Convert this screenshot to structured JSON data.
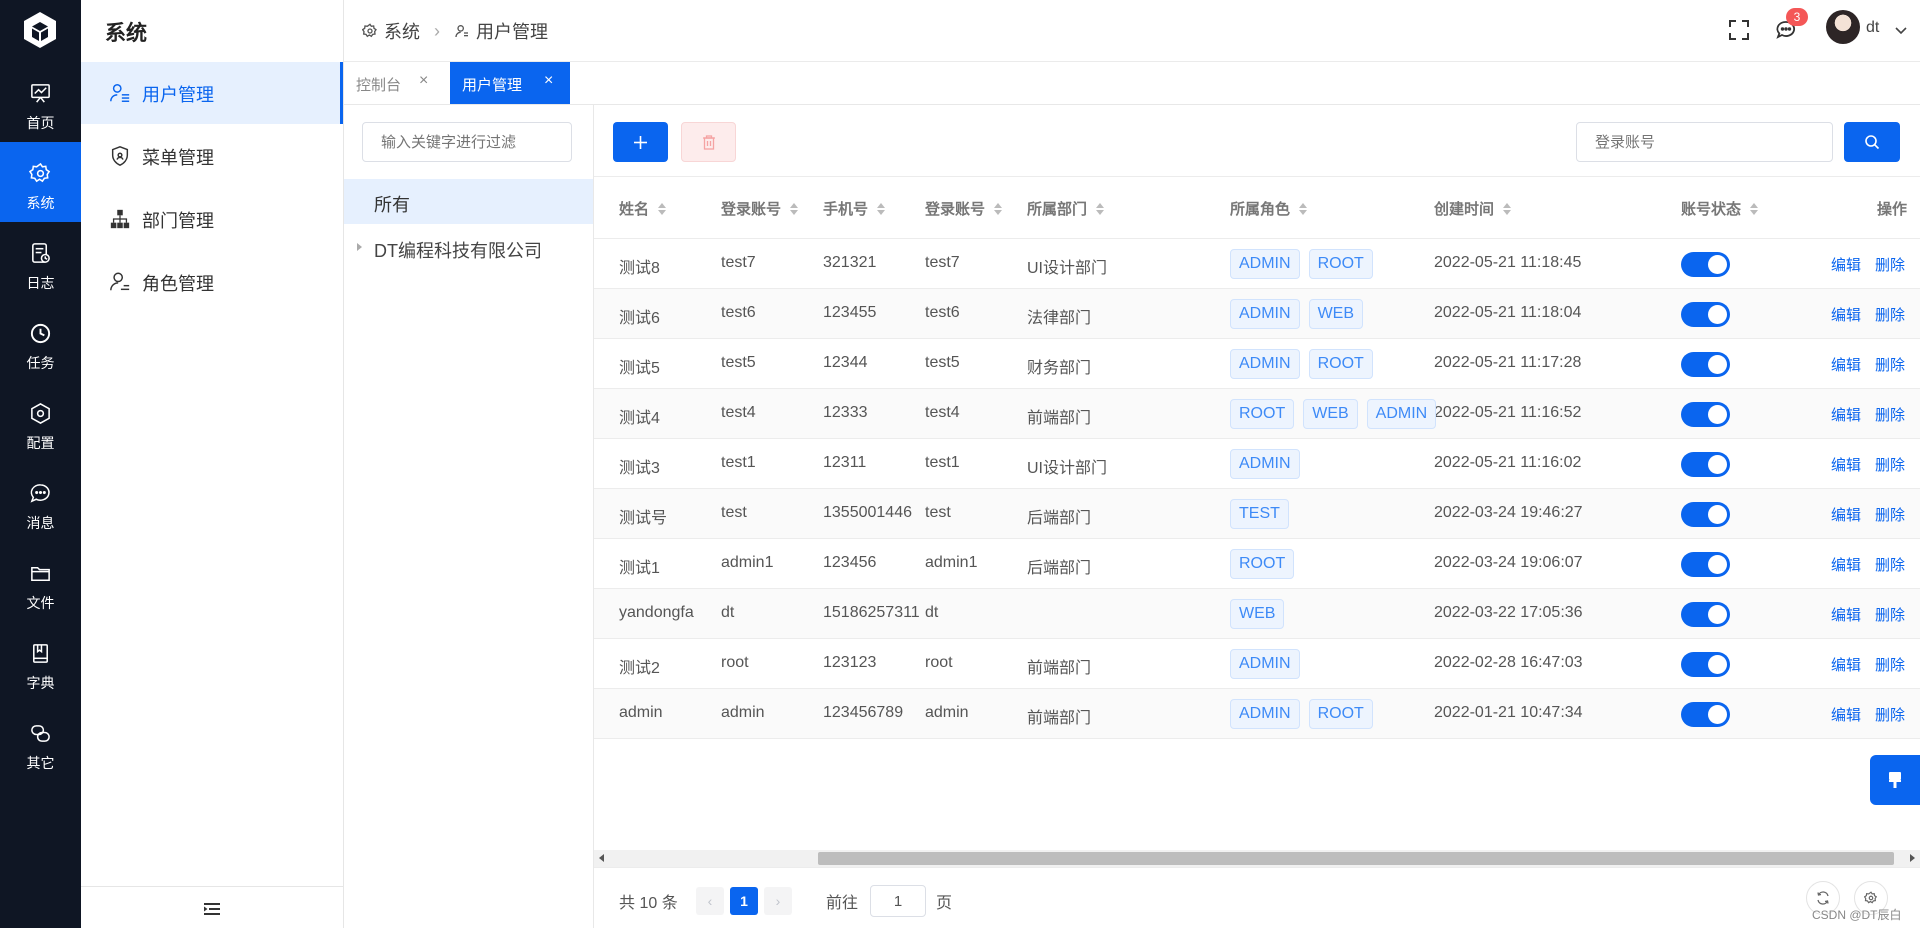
{
  "rail": {
    "items": [
      {
        "label": "首页",
        "icon": "chart-board-icon"
      },
      {
        "label": "系统",
        "icon": "gear-icon"
      },
      {
        "label": "日志",
        "icon": "log-icon"
      },
      {
        "label": "任务",
        "icon": "clock-icon"
      },
      {
        "label": "配置",
        "icon": "hexagon-settings-icon"
      },
      {
        "label": "消息",
        "icon": "chat-icon"
      },
      {
        "label": "文件",
        "icon": "folder-icon"
      },
      {
        "label": "字典",
        "icon": "book-icon"
      },
      {
        "label": "其它",
        "icon": "link-icon"
      }
    ],
    "active_index": 1
  },
  "sidebar": {
    "title": "系统",
    "items": [
      {
        "label": "用户管理",
        "icon": "user-list-icon"
      },
      {
        "label": "菜单管理",
        "icon": "shield-icon"
      },
      {
        "label": "部门管理",
        "icon": "org-chart-icon"
      },
      {
        "label": "角色管理",
        "icon": "user-role-icon"
      }
    ],
    "active_index": 0
  },
  "header": {
    "breadcrumb": [
      "系统",
      "用户管理"
    ],
    "notification_count": "3",
    "user_name": "dt"
  },
  "tabs": [
    {
      "label": "控制台",
      "active": false
    },
    {
      "label": "用户管理",
      "active": true
    }
  ],
  "tree": {
    "filter_placeholder": "输入关键字进行过滤",
    "all_label": "所有",
    "nodes": [
      "DT编程科技有限公司"
    ]
  },
  "toolbar": {
    "search_placeholder": "登录账号"
  },
  "table": {
    "columns": [
      "姓名",
      "登录账号",
      "手机号",
      "登录账号",
      "所属部门",
      "所属角色",
      "创建时间",
      "账号状态",
      "操作"
    ],
    "edit_label": "编辑",
    "delete_label": "删除",
    "rows": [
      {
        "name": "测试8",
        "account": "test7",
        "phone": "321321",
        "login": "test7",
        "dept": "UI设计部门",
        "roles": [
          "ADMIN",
          "ROOT"
        ],
        "created": "2022-05-21 11:18:45",
        "enabled": true
      },
      {
        "name": "测试6",
        "account": "test6",
        "phone": "123455",
        "login": "test6",
        "dept": "法律部门",
        "roles": [
          "ADMIN",
          "WEB"
        ],
        "created": "2022-05-21 11:18:04",
        "enabled": true
      },
      {
        "name": "测试5",
        "account": "test5",
        "phone": "12344",
        "login": "test5",
        "dept": "财务部门",
        "roles": [
          "ADMIN",
          "ROOT"
        ],
        "created": "2022-05-21 11:17:28",
        "enabled": true
      },
      {
        "name": "测试4",
        "account": "test4",
        "phone": "12333",
        "login": "test4",
        "dept": "前端部门",
        "roles": [
          "ROOT",
          "WEB",
          "ADMIN"
        ],
        "created": "2022-05-21 11:16:52",
        "enabled": true
      },
      {
        "name": "测试3",
        "account": "test1",
        "phone": "12311",
        "login": "test1",
        "dept": "UI设计部门",
        "roles": [
          "ADMIN"
        ],
        "created": "2022-05-21 11:16:02",
        "enabled": true
      },
      {
        "name": "测试号",
        "account": "test",
        "phone": "1355001446",
        "login": "test",
        "dept": "后端部门",
        "roles": [
          "TEST"
        ],
        "created": "2022-03-24 19:46:27",
        "enabled": true
      },
      {
        "name": "测试1",
        "account": "admin1",
        "phone": "123456",
        "login": "admin1",
        "dept": "后端部门",
        "roles": [
          "ROOT"
        ],
        "created": "2022-03-24 19:06:07",
        "enabled": true
      },
      {
        "name": "yandongfa",
        "account": "dt",
        "phone": "15186257311",
        "login": "dt",
        "dept": "",
        "roles": [
          "WEB"
        ],
        "created": "2022-03-22 17:05:36",
        "enabled": true
      },
      {
        "name": "测试2",
        "account": "root",
        "phone": "123123",
        "login": "root",
        "dept": "前端部门",
        "roles": [
          "ADMIN"
        ],
        "created": "2022-02-28 16:47:03",
        "enabled": true
      },
      {
        "name": "admin",
        "account": "admin",
        "phone": "123456789",
        "login": "admin",
        "dept": "前端部门",
        "roles": [
          "ADMIN",
          "ROOT"
        ],
        "created": "2022-01-21 10:47:34",
        "enabled": true
      }
    ]
  },
  "pagination": {
    "total_text": "共 10 条",
    "current_page": "1",
    "goto_label": "前往",
    "goto_value": "1",
    "page_unit": "页"
  },
  "watermark": "CSDN @DT辰白",
  "colors": {
    "accent": "#0a65ef",
    "rail_bg": "#0f1624",
    "danger_light": "#fdecec"
  }
}
